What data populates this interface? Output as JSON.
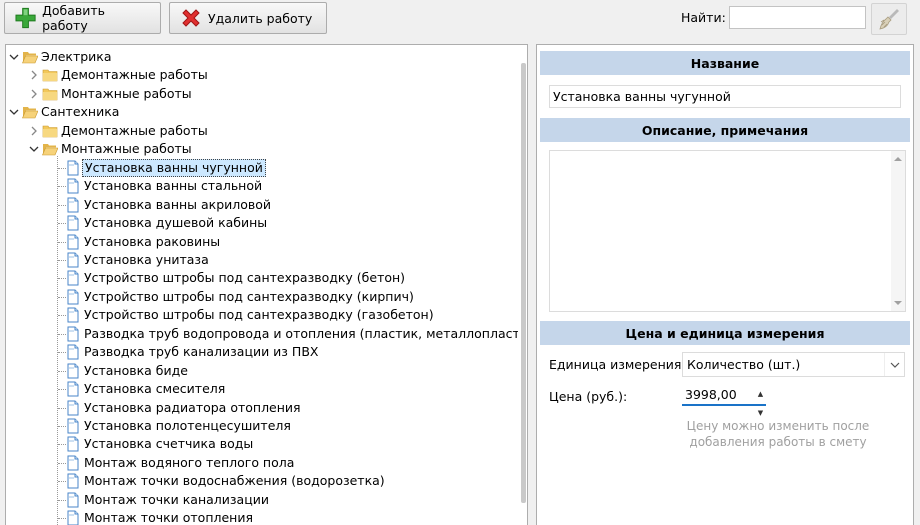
{
  "toolbar": {
    "add_label": "Добавить работу",
    "delete_label": "Удалить работу",
    "find_label": "Найти:",
    "find_value": ""
  },
  "tree": {
    "groups": [
      {
        "label": "Электрика",
        "expanded": true,
        "children": [
          {
            "label": "Демонтажные работы",
            "expanded": false
          },
          {
            "label": "Монтажные работы",
            "expanded": false
          }
        ]
      },
      {
        "label": "Сантехника",
        "expanded": true,
        "children": [
          {
            "label": "Демонтажные работы",
            "expanded": false
          },
          {
            "label": "Монтажные работы",
            "expanded": true
          }
        ]
      }
    ],
    "items": [
      "Установка ванны чугунной",
      "Установка ванны стальной",
      "Установка ванны акриловой",
      "Установка душевой кабины",
      "Установка раковины",
      "Установка унитаза",
      "Устройство штробы под сантехразводку (бетон)",
      "Устройство штробы под сантехразводку (кирпич)",
      "Устройство штробы под сантехразводку (газобетон)",
      "Разводка труб водопровода и отопления (пластик, металлопластик)",
      "Разводка труб канализации из ПВХ",
      "Установка биде",
      "Установка смесителя",
      "Установка радиатора отопления",
      "Установка полотенцесушителя",
      "Установка счетчика воды",
      "Монтаж водяного теплого пола",
      "Монтаж точки водоснабжения (водорозетка)",
      "Монтаж точки канализации",
      "Монтаж точки отопления"
    ],
    "selected_index": 0
  },
  "details": {
    "name_header": "Название",
    "name_value": "Установка ванны чугунной",
    "desc_header": "Описание, примечания",
    "desc_value": "",
    "price_header": "Цена и единица измерения",
    "unit_label": "Единица измерения:",
    "unit_value": "Количество (шт.)",
    "price_label": "Цена (руб.):",
    "price_value": "3998,00",
    "hint": "Цену можно изменить после добавления работы в смету"
  },
  "colors": {
    "section_header": "#c5d6ea",
    "selection": "#cce8ff",
    "hint_text": "#a0a0a0",
    "add_icon": "#3aa83a",
    "delete_icon": "#e03030"
  },
  "icons": {
    "add": "green-plus-icon",
    "delete": "red-x-icon",
    "clear": "broom-icon",
    "folder": "folder-icon",
    "folder_open": "folder-open-icon",
    "document": "document-icon"
  }
}
